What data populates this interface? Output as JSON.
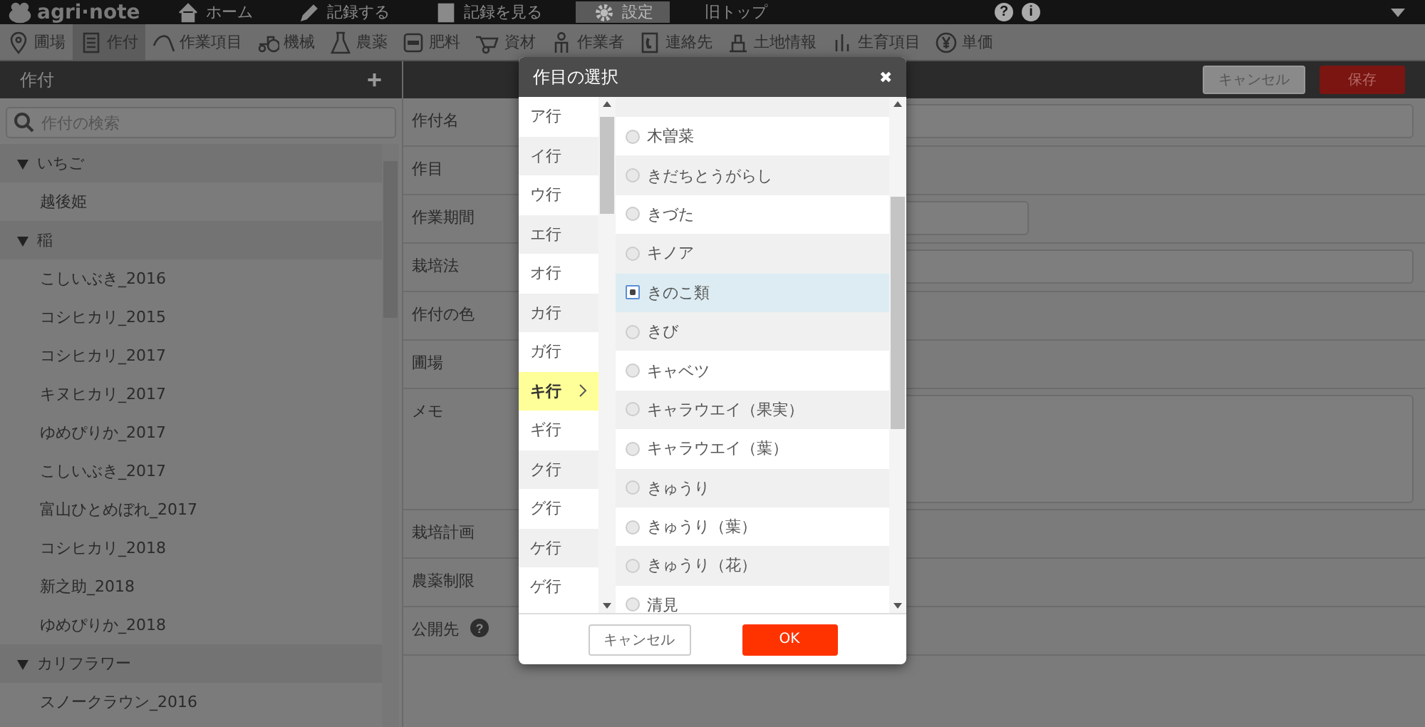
{
  "topbar": {
    "logo": "agri·note",
    "help": "?",
    "info": "i",
    "nav": [
      {
        "label": "ホーム",
        "selected": false
      },
      {
        "label": "記録する",
        "selected": false
      },
      {
        "label": "記録を見る",
        "selected": false
      },
      {
        "label": "設定",
        "selected": true
      },
      {
        "label": "旧トップ",
        "selected": false
      }
    ]
  },
  "toolbar": [
    {
      "label": "圃場",
      "selected": false
    },
    {
      "label": "作付",
      "selected": true
    },
    {
      "label": "作業項目",
      "selected": false
    },
    {
      "label": "機械",
      "selected": false
    },
    {
      "label": "農薬",
      "selected": false
    },
    {
      "label": "肥料",
      "selected": false
    },
    {
      "label": "資材",
      "selected": false
    },
    {
      "label": "作業者",
      "selected": false
    },
    {
      "label": "連絡先",
      "selected": false
    },
    {
      "label": "土地情報",
      "selected": false
    },
    {
      "label": "生育項目",
      "selected": false
    },
    {
      "label": "単価",
      "selected": false
    }
  ],
  "sidebar": {
    "title": "作付",
    "add": "+",
    "search": {
      "placeholder": "作付の検索"
    },
    "tree": [
      {
        "label": "いちご",
        "expanded": true,
        "children": [
          {
            "label": "越後姫"
          }
        ]
      },
      {
        "label": "稲",
        "expanded": true,
        "children": [
          {
            "label": "こしいぶき_2016"
          },
          {
            "label": "コシヒカリ_2015"
          },
          {
            "label": "コシヒカリ_2017"
          },
          {
            "label": "キヌヒカリ_2017"
          },
          {
            "label": "ゆめぴりか_2017"
          },
          {
            "label": "こしいぶき_2017"
          },
          {
            "label": "富山ひとめぼれ_2017"
          },
          {
            "label": "コシヒカリ_2018"
          },
          {
            "label": "新之助_2018"
          },
          {
            "label": "ゆめぴりか_2018"
          }
        ]
      },
      {
        "label": "カリフラワー",
        "expanded": true,
        "children": [
          {
            "label": "スノークラウン_2016"
          }
        ]
      }
    ]
  },
  "form": {
    "buttons": [
      {
        "label": "キャンセル",
        "kind": "cancel"
      },
      {
        "label": "保存",
        "kind": "save"
      }
    ],
    "rows": [
      {
        "label": "作付名",
        "kind": "input"
      },
      {
        "label": "作目",
        "kind": "none"
      },
      {
        "label": "作業期間",
        "kind": "date"
      },
      {
        "label": "栽培法",
        "kind": "input"
      },
      {
        "label": "作付の色",
        "kind": "none"
      },
      {
        "label": "圃場",
        "kind": "none"
      },
      {
        "label": "メモ",
        "kind": "textarea"
      },
      {
        "label": "栽培計画",
        "kind": "none"
      },
      {
        "label": "農薬制限",
        "kind": "none"
      },
      {
        "label": "公開先",
        "kind": "help",
        "help": "?"
      }
    ]
  },
  "dialog": {
    "title": "作目の選択",
    "close": "✖",
    "groups": [
      {
        "label": "ア行",
        "selected": false
      },
      {
        "label": "イ行",
        "selected": false
      },
      {
        "label": "ウ行",
        "selected": false
      },
      {
        "label": "エ行",
        "selected": false
      },
      {
        "label": "オ行",
        "selected": false
      },
      {
        "label": "カ行",
        "selected": false
      },
      {
        "label": "ガ行",
        "selected": false
      },
      {
        "label": "キ行",
        "selected": true
      },
      {
        "label": "ギ行",
        "selected": false
      },
      {
        "label": "ク行",
        "selected": false
      },
      {
        "label": "グ行",
        "selected": false
      },
      {
        "label": "ケ行",
        "selected": false
      },
      {
        "label": "ゲ行",
        "selected": false
      }
    ],
    "options": [
      {
        "label": "木曽菜",
        "selected": false
      },
      {
        "label": "きだちとうがらし",
        "selected": false
      },
      {
        "label": "きづた",
        "selected": false
      },
      {
        "label": "キノア",
        "selected": false
      },
      {
        "label": "きのこ類",
        "selected": true
      },
      {
        "label": "きび",
        "selected": false
      },
      {
        "label": "キャベツ",
        "selected": false
      },
      {
        "label": "キャラウエイ（果実）",
        "selected": false
      },
      {
        "label": "キャラウエイ（葉）",
        "selected": false
      },
      {
        "label": "きゅうり",
        "selected": false
      },
      {
        "label": "きゅうり（葉）",
        "selected": false
      },
      {
        "label": "きゅうり（花）",
        "selected": false
      },
      {
        "label": "清見",
        "selected": false
      }
    ],
    "buttons": [
      {
        "label": "キャンセル",
        "kind": "cancel"
      },
      {
        "label": "OK",
        "kind": "ok"
      }
    ]
  }
}
